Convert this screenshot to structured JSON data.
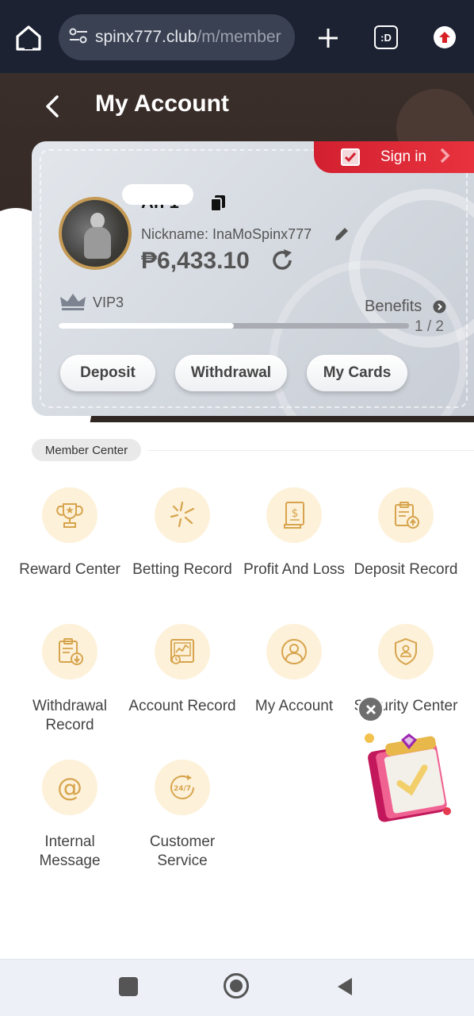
{
  "browser": {
    "url_host": "spinx777.club",
    "url_path": "/m/member",
    "tabs_label": ":D"
  },
  "header": {
    "title": "My Account"
  },
  "card": {
    "sign_in_label": "Sign in",
    "account_id": "An  1",
    "nickname": "Nickname: InaMoSpinx777",
    "balance": "₱6,433.10",
    "vip_level": "VIP3",
    "benefits_label": "Benefits",
    "progress_text": "1 / 2",
    "progress_fraction": 0.5,
    "buttons": {
      "deposit": "Deposit",
      "withdrawal": "Withdrawal",
      "my_cards": "My Cards"
    }
  },
  "member_center": {
    "title": "Member Center",
    "items": [
      {
        "label": "Reward Center",
        "icon": "trophy-icon"
      },
      {
        "label": "Betting Record",
        "icon": "betting-star-icon"
      },
      {
        "label": "Profit And Loss",
        "icon": "receipt-dollar-icon"
      },
      {
        "label": "Deposit Record",
        "icon": "clipboard-upload-icon"
      },
      {
        "label": "Withdrawal Record",
        "icon": "clipboard-download-icon"
      },
      {
        "label": "Account Record",
        "icon": "ledger-chart-icon"
      },
      {
        "label": "My Account",
        "icon": "user-circle-icon"
      },
      {
        "label": "Security Center",
        "icon": "shield-user-icon"
      },
      {
        "label": "Internal Message",
        "icon": "at-sign-icon"
      },
      {
        "label": "Customer Service",
        "icon": "support-24-7-icon"
      }
    ]
  },
  "colors": {
    "browser_bar": "#1c2232",
    "header_bg": "#3a2e2a",
    "sign_in_red": "#d32030",
    "avatar_border": "#c59a54",
    "icon_circle": "#fdf1d9",
    "icon_stroke": "#d7a44d"
  }
}
